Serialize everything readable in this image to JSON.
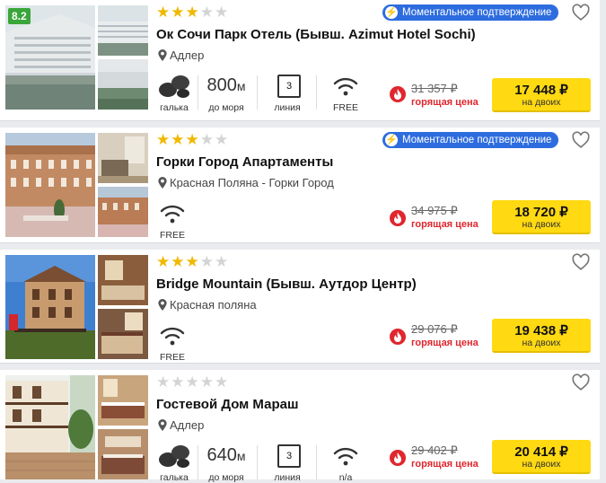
{
  "common": {
    "badge_text": "Моментальное подтверждение",
    "hot_label": "горящая цена",
    "price_sub": "на двоих",
    "lbl_pebbles": "галька",
    "lbl_to_sea": "до моря",
    "lbl_line": "линия",
    "currency": "₽"
  },
  "hotels": [
    {
      "score": "8.2",
      "stars": 3,
      "instant": true,
      "name": "Ок Сочи Парк Отель (Бывш. Azimut Hotel Sochi)",
      "location": "Адлер",
      "distance_num": "800",
      "distance_unit": "м",
      "line": "3",
      "wifi": "FREE",
      "old_price": "31 357 ₽",
      "price": "17 448 ₽"
    },
    {
      "stars": 3,
      "instant": true,
      "name": "Горки Город Апартаменты",
      "location": "Красная Поляна - Горки Город",
      "wifi": "FREE",
      "old_price": "34 975 ₽",
      "price": "18 720 ₽"
    },
    {
      "stars": 3,
      "instant": false,
      "name": "Bridge Mountain (Бывш. Аутдор Центр)",
      "location": "Красная поляна",
      "wifi": "FREE",
      "old_price": "29 076 ₽",
      "price": "19 438 ₽"
    },
    {
      "stars": 0,
      "instant": false,
      "name": "Гостевой Дом Мараш",
      "location": "Адлер",
      "distance_num": "640",
      "distance_unit": "м",
      "line": "3",
      "wifi": "n/a",
      "old_price": "29 402 ₽",
      "price": "20 414 ₽"
    }
  ],
  "colors": {
    "star_on": "#f0b800",
    "star_off": "#d4d4d4",
    "badge_blue": "#2d6cdf",
    "hot_red": "#e0262e",
    "price_yellow": "#ffd911",
    "score_green": "#3aa63a"
  },
  "icons": {
    "pebbles": "pebbles-icon",
    "wifi": "wifi-icon",
    "pin": "location-pin-icon",
    "heart": "heart-icon",
    "fire": "fire-icon",
    "bolt": "lightning-icon"
  }
}
